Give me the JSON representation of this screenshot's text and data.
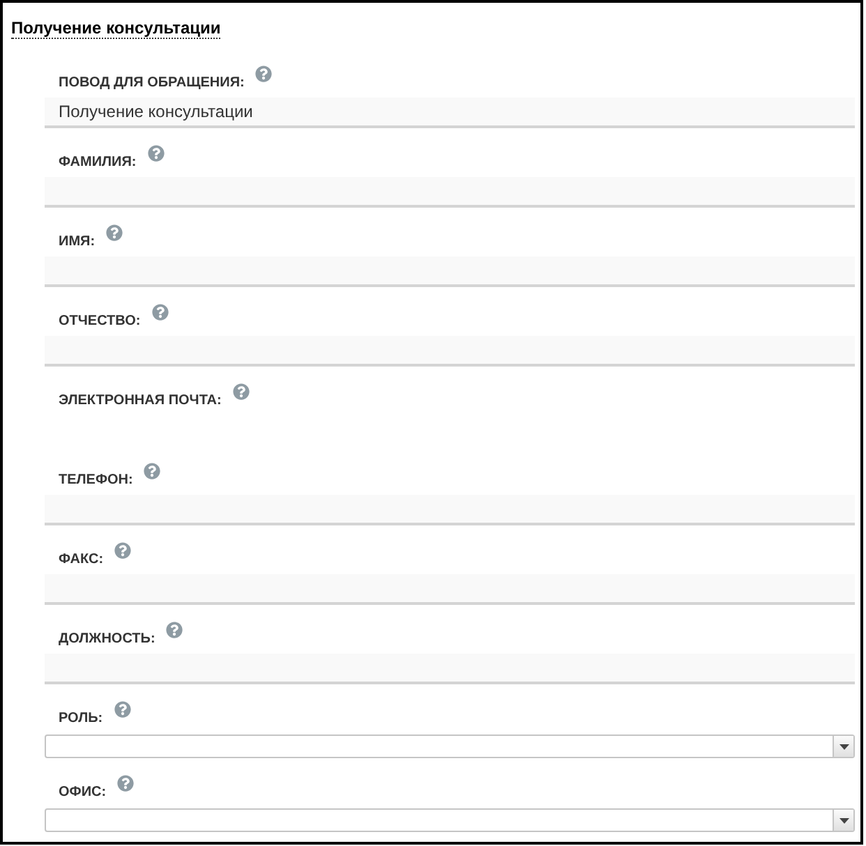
{
  "title": "Получение консультации",
  "fields": [
    {
      "label": "ПОВОД ДЛЯ ОБРАЩЕНИЯ:",
      "kind": "text",
      "value": "Получение консультации"
    },
    {
      "label": "ФАМИЛИЯ:",
      "kind": "text"
    },
    {
      "label": "ИМЯ:",
      "kind": "text"
    },
    {
      "label": "ОТЧЕСТВО:",
      "kind": "text"
    },
    {
      "label": "ЭЛЕКТРОННАЯ ПОЧТА:",
      "kind": "blank"
    },
    {
      "label": "ТЕЛЕФОН:",
      "kind": "text"
    },
    {
      "label": "ФАКС:",
      "kind": "text"
    },
    {
      "label": "ДОЛЖНОСТЬ:",
      "kind": "text"
    },
    {
      "label": "РОЛЬ:",
      "kind": "select"
    },
    {
      "label": "ОФИС:",
      "kind": "select"
    }
  ]
}
